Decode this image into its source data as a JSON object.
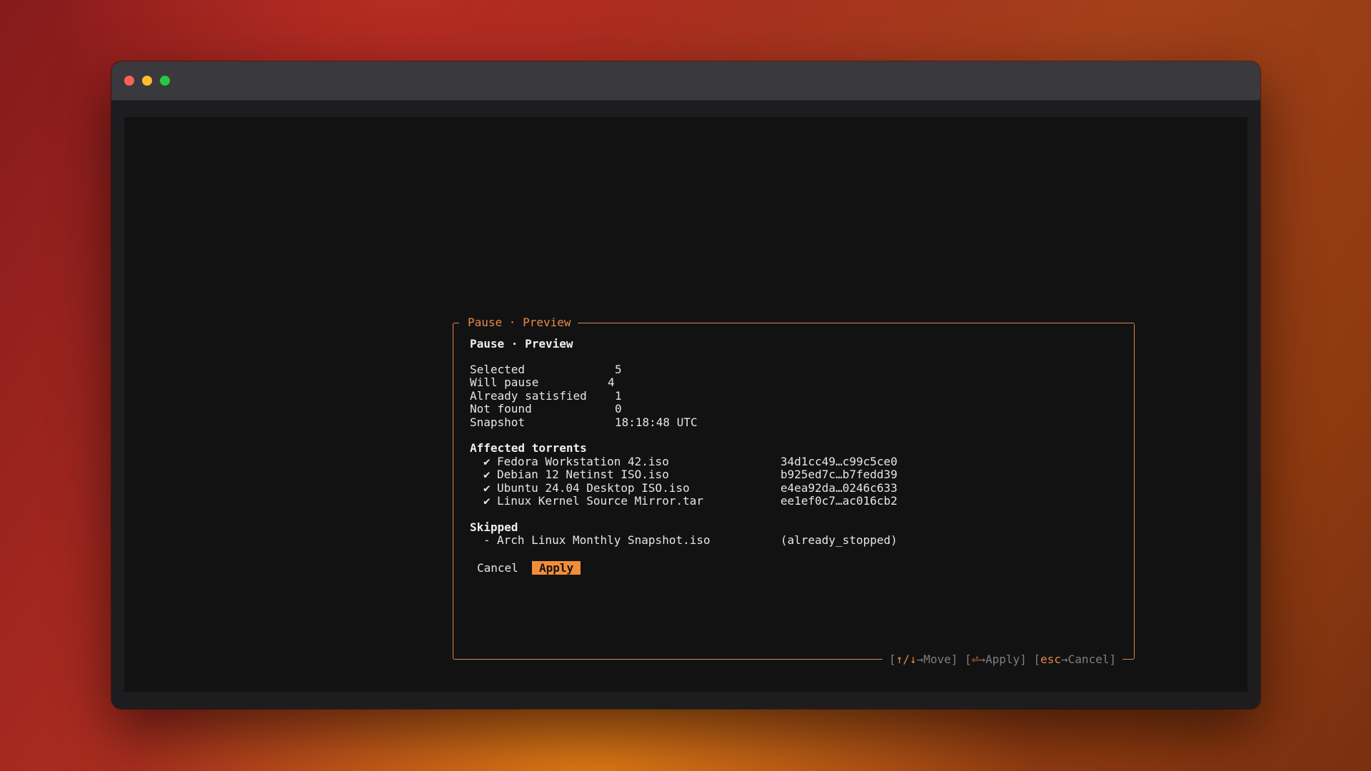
{
  "window": {
    "traffic_lights": [
      "close",
      "minimize",
      "zoom"
    ],
    "colors": {
      "close": "#ff5f57",
      "minimize": "#febc2e",
      "zoom": "#28c840",
      "accent": "#f28d3a"
    }
  },
  "dialog": {
    "legend": "Pause · Preview",
    "heading": "Pause · Preview",
    "summary": [
      {
        "label": "Selected",
        "value": "5"
      },
      {
        "label": "Will pause",
        "value": "4"
      },
      {
        "label": "Already satisfied",
        "value": "1"
      },
      {
        "label": "Not found",
        "value": "0"
      },
      {
        "label": "Snapshot",
        "value": "18:18:48 UTC"
      }
    ],
    "affected_heading": "Affected torrents",
    "affected": [
      {
        "mark": "✔",
        "name": "Fedora Workstation 42.iso",
        "hash": "34d1cc49…c99c5ce0"
      },
      {
        "mark": "✔",
        "name": "Debian 12 Netinst ISO.iso",
        "hash": "b925ed7c…b7fedd39"
      },
      {
        "mark": "✔",
        "name": "Ubuntu 24.04 Desktop ISO.iso",
        "hash": "e4ea92da…0246c633"
      },
      {
        "mark": "✔",
        "name": "Linux Kernel Source Mirror.tar",
        "hash": "ee1ef0c7…ac016cb2"
      }
    ],
    "skipped_heading": "Skipped",
    "skipped": [
      {
        "mark": "-",
        "name": "Arch Linux Monthly Snapshot.iso",
        "reason": "(already_stopped)"
      }
    ],
    "buttons": {
      "cancel": "Cancel",
      "apply": "Apply"
    },
    "footer_hints": [
      {
        "key": "↑/↓",
        "action": "→Move"
      },
      {
        "key": "⏎",
        "action": "→Apply"
      },
      {
        "key": "esc",
        "action": "→Cancel"
      }
    ]
  }
}
